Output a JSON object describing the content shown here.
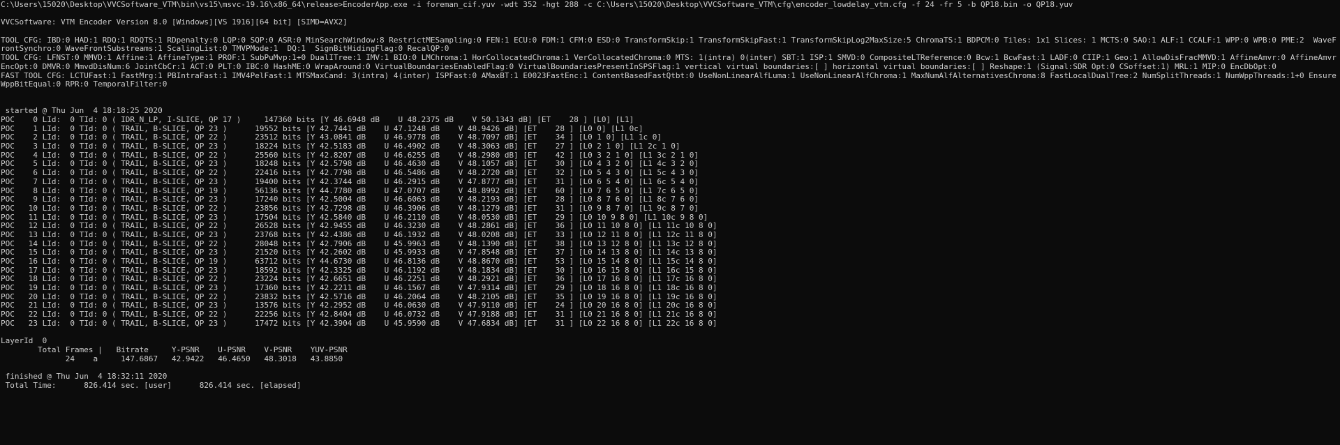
{
  "console": {
    "command": "C:\\Users\\15020\\Desktop\\VVCSoftware_VTM\\bin\\vs15\\msvc-19.16\\x86_64\\release>EncoderApp.exe -i foreman_cif.yuv -wdt 352 -hgt 288 -c C:\\Users\\15020\\Desktop\\VVCSoftware_VTM\\cfg\\encoder_lowdelay_vtm.cfg -f 24 -fr 5 -b QP18.bin -o QP18.yuv",
    "version": "VVCSoftware: VTM Encoder Version 8.0 [Windows][VS 1916][64 bit] [SIMD=AVX2]",
    "tool_cfg_1": "TOOL CFG: IBD:0 HAD:1 RDQ:1 RDQTS:1 RDpenalty:0 LQP:0 SQP:0 ASR:0 MinSearchWindow:8 RestrictMESampling:0 FEN:1 ECU:0 FDM:1 CFM:0 ESD:0 TransformSkip:1 TransformSkipFast:1 TransformSkipLog2MaxSize:5 ChromaTS:1 BDPCM:0 Tiles: 1x1 Slices: 1 MCTS:0 SAO:1 ALF:1 CCALF:1 WPP:0 WPB:0 PME:2  WaveFrontSynchro:0 WaveFrontSubstreams:1 ScalingList:0 TMVPMode:1  DQ:1  SignBitHidingFlag:0 RecalQP:0",
    "tool_cfg_2": "TOOL CFG: LFNST:0 MMVD:1 Affine:1 AffineType:1 PROF:1 SubPuMvp:1+0 DualITree:1 IMV:1 BIO:0 LMChroma:1 HorCollocatedChroma:1 VerCollocatedChroma:0 MTS: 1(intra) 0(inter) SBT:1 ISP:1 SMVD:0 CompositeLTReference:0 Bcw:1 BcwFast:1 LADF:0 CIIP:1 Geo:1 AllowDisFracMMVD:1 AffineAmvr:0 AffineAmvrEncOpt:0 DMVR:0 MmvdDisNum:6 JointCbCr:1 ACT:0 PLT:0 IBC:0 HashME:0 WrapAround:0 VirtualBoundariesEnabledFlag:0 VirtualBoundariesPresentInSPSFlag:1 vertical virtual boundaries:[ ] horizontal virtual boundaries:[ ] Reshape:1 (Signal:SDR Opt:0 CSoffset:1) MRL:1 MIP:0 EncDbOpt:0",
    "fast_tool_cfg": "FAST TOOL CFG: LCTUFast:1 FastMrg:1 PBIntraFast:1 IMV4PelFast:1 MTSMaxCand: 3(intra) 4(inter) ISPFast:0 AMaxBT:1 E0023FastEnc:1 ContentBasedFastQtbt:0 UseNonLinearAlfLuma:1 UseNonLinearAlfChroma:1 MaxNumAlfAlternativesChroma:8 FastLocalDualTree:2 NumSplitThreads:1 NumWppThreads:1+0 EnsureWppBitEqual:0 RPR:0 TemporalFilter:0",
    "started": " started @ Thu Jun  4 18:18:25 2020",
    "poc_lines": [
      "POC    0 LId:  0 TId: 0 ( IDR_N_LP, I-SLICE, QP 17 )     147360 bits [Y 46.6948 dB    U 48.2375 dB    V 50.1343 dB] [ET    28 ] [L0] [L1]",
      "POC    1 LId:  0 TId: 0 ( TRAIL, B-SLICE, QP 23 )      19552 bits [Y 42.7441 dB    U 47.1248 dB    V 48.9426 dB] [ET    28 ] [L0 0] [L1 0c]",
      "POC    2 LId:  0 TId: 0 ( TRAIL, B-SLICE, QP 22 )      23512 bits [Y 43.0841 dB    U 46.9778 dB    V 48.7097 dB] [ET    34 ] [L0 1 0] [L1 1c 0]",
      "POC    3 LId:  0 TId: 0 ( TRAIL, B-SLICE, QP 23 )      18224 bits [Y 42.5183 dB    U 46.4902 dB    V 48.3063 dB] [ET    27 ] [L0 2 1 0] [L1 2c 1 0]",
      "POC    4 LId:  0 TId: 0 ( TRAIL, B-SLICE, QP 22 )      25560 bits [Y 42.8207 dB    U 46.6255 dB    V 48.2980 dB] [ET    42 ] [L0 3 2 1 0] [L1 3c 2 1 0]",
      "POC    5 LId:  0 TId: 0 ( TRAIL, B-SLICE, QP 23 )      18248 bits [Y 42.5798 dB    U 46.4630 dB    V 48.1057 dB] [ET    30 ] [L0 4 3 2 0] [L1 4c 3 2 0]",
      "POC    6 LId:  0 TId: 0 ( TRAIL, B-SLICE, QP 22 )      22416 bits [Y 42.7798 dB    U 46.5486 dB    V 48.2720 dB] [ET    32 ] [L0 5 4 3 0] [L1 5c 4 3 0]",
      "POC    7 LId:  0 TId: 0 ( TRAIL, B-SLICE, QP 23 )      19400 bits [Y 42.3744 dB    U 46.2915 dB    V 47.8777 dB] [ET    31 ] [L0 6 5 4 0] [L1 6c 5 4 0]",
      "POC    8 LId:  0 TId: 0 ( TRAIL, B-SLICE, QP 19 )      56136 bits [Y 44.7780 dB    U 47.0707 dB    V 48.8992 dB] [ET    60 ] [L0 7 6 5 0] [L1 7c 6 5 0]",
      "POC    9 LId:  0 TId: 0 ( TRAIL, B-SLICE, QP 23 )      17240 bits [Y 42.5004 dB    U 46.6063 dB    V 48.2193 dB] [ET    28 ] [L0 8 7 6 0] [L1 8c 7 6 0]",
      "POC   10 LId:  0 TId: 0 ( TRAIL, B-SLICE, QP 22 )      23856 bits [Y 42.7298 dB    U 46.3906 dB    V 48.1279 dB] [ET    31 ] [L0 9 8 7 0] [L1 9c 8 7 0]",
      "POC   11 LId:  0 TId: 0 ( TRAIL, B-SLICE, QP 23 )      17504 bits [Y 42.5840 dB    U 46.2110 dB    V 48.0530 dB] [ET    29 ] [L0 10 9 8 0] [L1 10c 9 8 0]",
      "POC   12 LId:  0 TId: 0 ( TRAIL, B-SLICE, QP 22 )      26528 bits [Y 42.9455 dB    U 46.3230 dB    V 48.2861 dB] [ET    36 ] [L0 11 10 8 0] [L1 11c 10 8 0]",
      "POC   13 LId:  0 TId: 0 ( TRAIL, B-SLICE, QP 23 )      23768 bits [Y 42.4386 dB    U 46.1932 dB    V 48.0208 dB] [ET    33 ] [L0 12 11 8 0] [L1 12c 11 8 0]",
      "POC   14 LId:  0 TId: 0 ( TRAIL, B-SLICE, QP 22 )      28048 bits [Y 42.7906 dB    U 45.9963 dB    V 48.1390 dB] [ET    38 ] [L0 13 12 8 0] [L1 13c 12 8 0]",
      "POC   15 LId:  0 TId: 0 ( TRAIL, B-SLICE, QP 23 )      21520 bits [Y 42.2602 dB    U 45.9933 dB    V 47.8548 dB] [ET    37 ] [L0 14 13 8 0] [L1 14c 13 8 0]",
      "POC   16 LId:  0 TId: 0 ( TRAIL, B-SLICE, QP 19 )      63712 bits [Y 44.6730 dB    U 46.8136 dB    V 48.8670 dB] [ET    53 ] [L0 15 14 8 0] [L1 15c 14 8 0]",
      "POC   17 LId:  0 TId: 0 ( TRAIL, B-SLICE, QP 23 )      18592 bits [Y 42.3325 dB    U 46.1192 dB    V 48.1834 dB] [ET    30 ] [L0 16 15 8 0] [L1 16c 15 8 0]",
      "POC   18 LId:  0 TId: 0 ( TRAIL, B-SLICE, QP 22 )      23224 bits [Y 42.6651 dB    U 46.2251 dB    V 48.2921 dB] [ET    36 ] [L0 17 16 8 0] [L1 17c 16 8 0]",
      "POC   19 LId:  0 TId: 0 ( TRAIL, B-SLICE, QP 23 )      17360 bits [Y 42.2211 dB    U 46.1567 dB    V 47.9314 dB] [ET    29 ] [L0 18 16 8 0] [L1 18c 16 8 0]",
      "POC   20 LId:  0 TId: 0 ( TRAIL, B-SLICE, QP 22 )      23832 bits [Y 42.5716 dB    U 46.2064 dB    V 48.2105 dB] [ET    35 ] [L0 19 16 8 0] [L1 19c 16 8 0]",
      "POC   21 LId:  0 TId: 0 ( TRAIL, B-SLICE, QP 23 )      13576 bits [Y 42.2952 dB    U 46.0630 dB    V 47.9110 dB] [ET    24 ] [L0 20 16 8 0] [L1 20c 16 8 0]",
      "POC   22 LId:  0 TId: 0 ( TRAIL, B-SLICE, QP 22 )      22256 bits [Y 42.8404 dB    U 46.0732 dB    V 47.9188 dB] [ET    31 ] [L0 21 16 8 0] [L1 21c 16 8 0]",
      "POC   23 LId:  0 TId: 0 ( TRAIL, B-SLICE, QP 23 )      17472 bits [Y 42.3904 dB    U 45.9590 dB    V 47.6834 dB] [ET    31 ] [L0 22 16 8 0] [L1 22c 16 8 0]"
    ],
    "layer_id": "LayerId  0",
    "summary_header": "        Total Frames |   Bitrate     Y-PSNR    U-PSNR    V-PSNR    YUV-PSNR",
    "summary_values": "              24    a     147.6867   42.9422   46.4650   48.3018   43.8850",
    "finished": " finished @ Thu Jun  4 18:32:11 2020",
    "total_time": " Total Time:      826.414 sec. [user]      826.414 sec. [elapsed]"
  }
}
